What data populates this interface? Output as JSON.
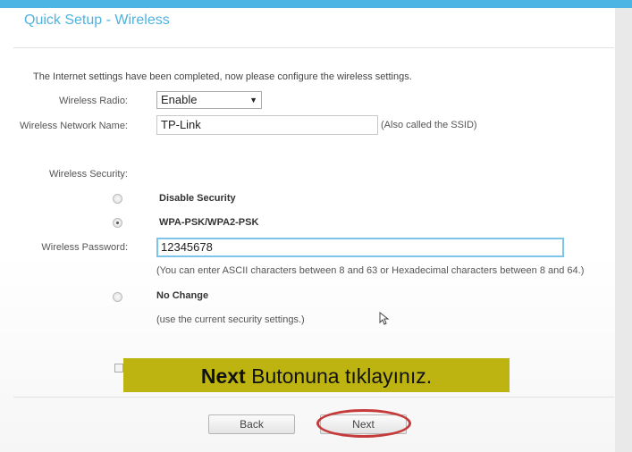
{
  "title": "Quick Setup - Wireless",
  "intro": "The Internet settings have been completed, now please configure the wireless settings.",
  "wireless_radio": {
    "label": "Wireless Radio:",
    "value": "Enable"
  },
  "network_name": {
    "label": "Wireless Network Name:",
    "value": "TP-Link",
    "hint": "(Also called the SSID)"
  },
  "security": {
    "label": "Wireless Security:",
    "options": [
      {
        "label": "Disable Security",
        "checked": false
      },
      {
        "label": "WPA-PSK/WPA2-PSK",
        "checked": true
      },
      {
        "label": "No Change",
        "checked": false
      }
    ]
  },
  "password": {
    "label": "Wireless Password:",
    "value": "12345678",
    "hint": "(You can enter ASCII characters between 8 and 63 or Hexadecimal characters between 8 and 64.)"
  },
  "no_change_hint": "(use the current security settings.)",
  "banner": {
    "bold": "Next",
    "rest": " Butonuna tıklayınız."
  },
  "buttons": {
    "back": "Back",
    "next": "Next"
  },
  "colors": {
    "title": "#4fb3de",
    "topbar": "#4cb5e3",
    "banner": "#bdb411",
    "highlight_ring": "#c53a3a"
  }
}
